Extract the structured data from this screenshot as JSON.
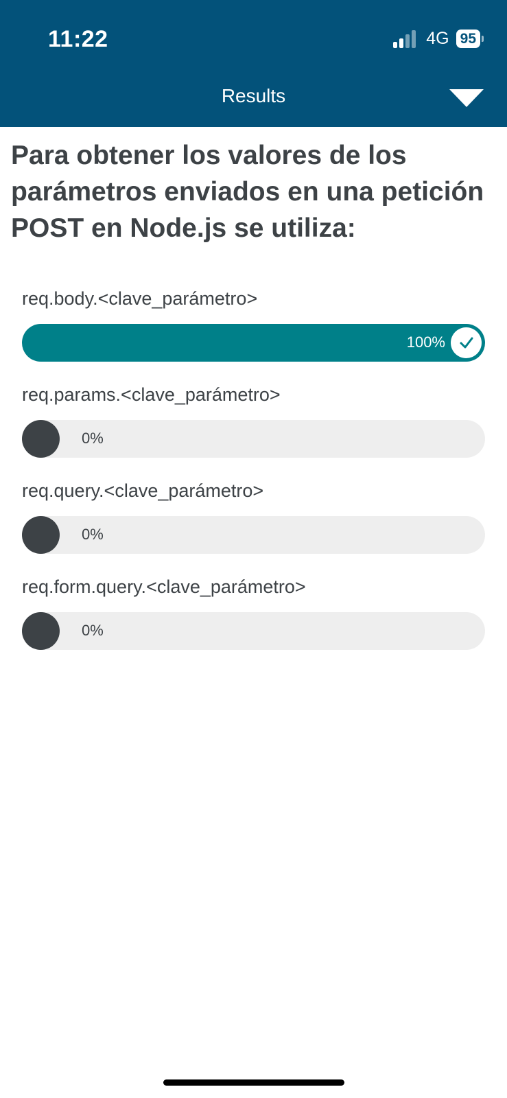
{
  "status_bar": {
    "time": "11:22",
    "network": "4G",
    "battery": "95"
  },
  "header": {
    "title": "Results"
  },
  "question": "Para obtener los valores de los parámetros enviados en una petición POST en Node.js se utiliza:",
  "options": [
    {
      "label": "req.body.<clave_parámetro>",
      "percent_text": "100%",
      "percent": 100,
      "correct": true
    },
    {
      "label": "req.params.<clave_parámetro>",
      "percent_text": "0%",
      "percent": 0,
      "correct": false
    },
    {
      "label": "req.query.<clave_parámetro>",
      "percent_text": "0%",
      "percent": 0,
      "correct": false
    },
    {
      "label": "req.form.query.<clave_parámetro>",
      "percent_text": "0%",
      "percent": 0,
      "correct": false
    }
  ],
  "colors": {
    "header_bg": "#03527a",
    "correct_fill": "#008089",
    "empty_track": "#eeeeee",
    "dot": "#3d4246"
  }
}
